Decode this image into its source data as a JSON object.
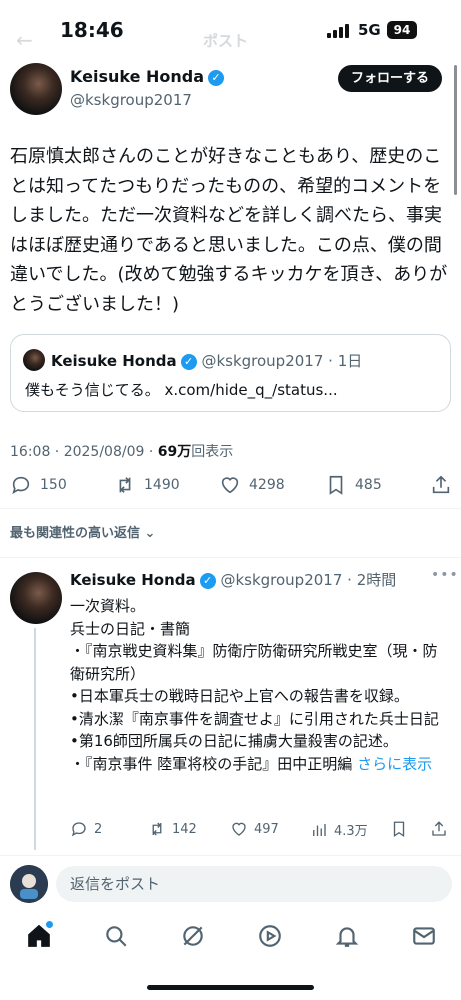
{
  "status_bar": {
    "time": "18:46",
    "network": "5G",
    "battery": "94"
  },
  "header": {
    "title": "ポスト"
  },
  "post": {
    "author_name": "Keisuke Honda",
    "author_handle": "@kskgroup2017",
    "follow_label": "フォローする",
    "text": "石原慎太郎さんのことが好きなこともあり、歴史のことは知ってたつもりだったものの、希望的コメントをしました。ただ一次資料などを詳しく調べたら、事実はほぼ歴史通りであると思いました。この点、僕の間違いでした。(改めて勉強するキッカケを頂き、ありがとうございました！)",
    "quote": {
      "author_name": "Keisuke Honda",
      "author_handle": "@kskgroup2017",
      "time_ago": "1日",
      "text": "僕もそう信じてる。 x.com/hide_q_/status..."
    },
    "timestamp": "16:08 · 2025/08/09",
    "views_count": "69万",
    "views_label": "回表示",
    "stats": {
      "replies": "150",
      "reposts": "1490",
      "likes": "4298",
      "bookmarks": "485"
    }
  },
  "replies_sort": "最も関連性の高い返信",
  "reply": {
    "author_name": "Keisuke Honda",
    "author_handle": "@kskgroup2017",
    "time_ago": "2時間",
    "lines": [
      "一次資料。",
      "兵士の日記・書簡",
      "・『南京戦史資料集』防衛庁防衛研究所戦史室（現・防衛研究所）",
      "•日本軍兵士の戦時日記や上官への報告書を収録。",
      "•清水潔『南京事件を調査せよ』に引用された兵士日記",
      "•第16師団所属兵の日記に捕虜大量殺害の記述。",
      "・『南京事件 陸軍将校の手記』田中正明編"
    ],
    "more_label": "さらに表示",
    "stats": {
      "replies": "2",
      "reposts": "142",
      "likes": "497",
      "views": "4.3万"
    }
  },
  "composer": {
    "placeholder": "返信をポスト"
  },
  "colors": {
    "accent": "#1d9bf0",
    "text": "#0f1419",
    "secondary": "#536471"
  },
  "tabs": [
    "home-icon",
    "search-icon",
    "grok-icon",
    "video-icon",
    "notifications-icon",
    "messages-icon"
  ]
}
